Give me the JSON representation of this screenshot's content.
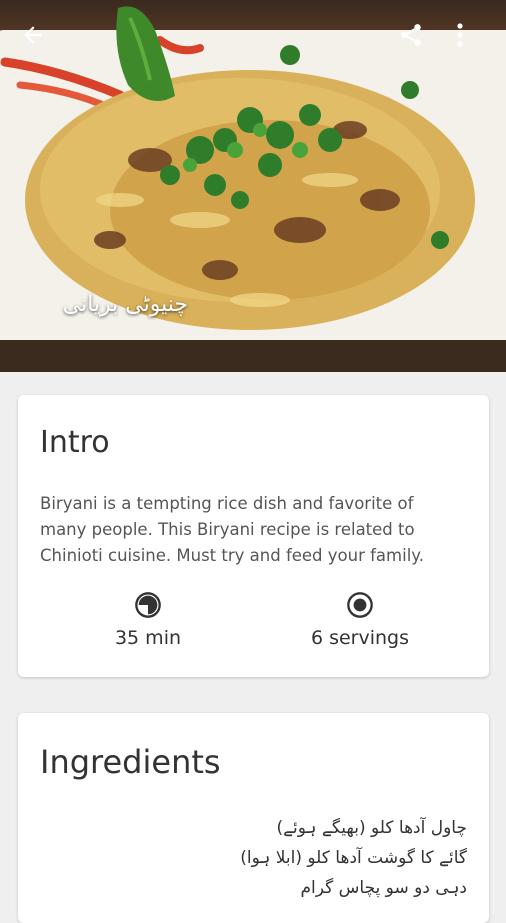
{
  "header": {
    "dish_name": "چنیوٹی بریانی"
  },
  "intro": {
    "title": "Intro",
    "description": "Biryani is a tempting rice dish and favorite of many people. This Biryani recipe is related to Chinioti cuisine. Must try and feed your family.",
    "time": "35 min",
    "servings": "6 servings"
  },
  "ingredients": {
    "title": "Ingredients",
    "items": [
      "چاول آدھا کلو (بھیگے ہوئے)",
      "گائے کا گوشت آدھا کلو (ابلا ہوا)",
      "دہی دو سو پچاس گرام"
    ]
  },
  "colors": {
    "background": "#efefef",
    "card": "#ffffff",
    "text_primary": "#333333",
    "text_secondary": "#555555"
  }
}
